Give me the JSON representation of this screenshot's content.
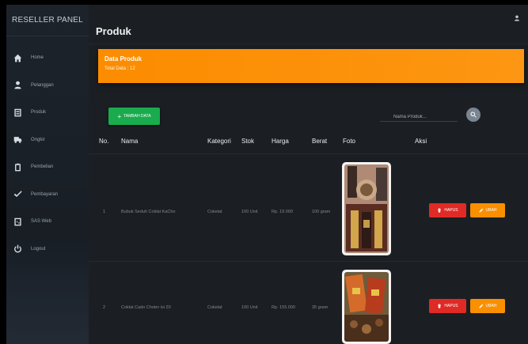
{
  "sidebar": {
    "brand": "RESELLER PANEL",
    "items": [
      {
        "label": "Home",
        "icon": "home-icon"
      },
      {
        "label": "Pelanggan",
        "icon": "user-icon"
      },
      {
        "label": "Produk",
        "icon": "product-icon"
      },
      {
        "label": "Ongkir",
        "icon": "truck-icon"
      },
      {
        "label": "Pembelian",
        "icon": "clipboard-icon"
      },
      {
        "label": "Pembayaran",
        "icon": "check-icon"
      },
      {
        "label": "SAS Web",
        "icon": "web-icon"
      },
      {
        "label": "Logout",
        "icon": "power-icon"
      }
    ]
  },
  "header": {
    "title": "Produk"
  },
  "banner": {
    "title": "Data Produk",
    "subtitle": "Total Data : 12",
    "color": "#fd8f05"
  },
  "toolbar": {
    "add_label": "TAMBAH DATA",
    "search_placeholder": "Nama Produk..."
  },
  "table": {
    "headers": [
      "No.",
      "Nama",
      "Kategori",
      "Stok",
      "Harga",
      "Berat",
      "Foto",
      "Aksi"
    ],
    "rows": [
      {
        "no": "1",
        "nama": "Bubuk Seduh Coklat KaCho",
        "kategori": "Cokelat",
        "stok": "100 Unit",
        "harga": "Rp. 19.000",
        "berat": "100 gram"
      },
      {
        "no": "2",
        "nama": "Coklat Cado Choter isi 20",
        "kategori": "Cokelat",
        "stok": "100 Unit",
        "harga": "Rp. 155.000",
        "berat": "35 gram"
      }
    ],
    "delete_label": "HAPUS",
    "edit_label": "UBAH"
  },
  "colors": {
    "add": "#1aab4e",
    "delete": "#e02a25",
    "edit": "#fa8f00"
  }
}
